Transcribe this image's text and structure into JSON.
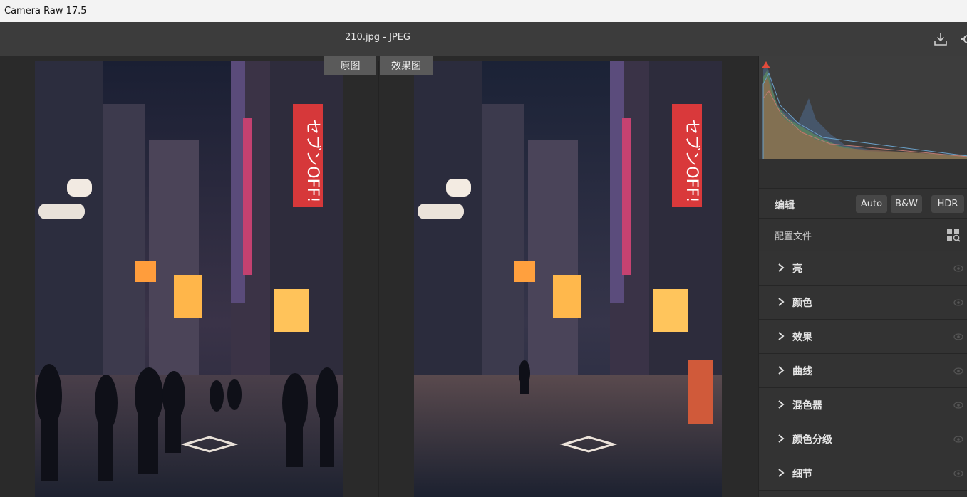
{
  "app": {
    "title": "Camera Raw 17.5"
  },
  "toolbar": {
    "file_title": "210.jpg -  JPEG",
    "export_icon": "export-icon",
    "settings_icon": "gear-icon"
  },
  "view_tabs": {
    "original": "原图",
    "edited": "效果图"
  },
  "panel": {
    "edit_label": "编辑",
    "modes": {
      "auto": "Auto",
      "bw": "B&W",
      "hdr": "HDR"
    },
    "profile_label": "配置文件",
    "sections": [
      {
        "label": "亮"
      },
      {
        "label": "颜色"
      },
      {
        "label": "效果"
      },
      {
        "label": "曲线"
      },
      {
        "label": "混色器"
      },
      {
        "label": "颜色分级"
      },
      {
        "label": "细节"
      }
    ]
  },
  "colors": {
    "titlebar": "#f3f3f3",
    "toolbar": "#3c3c3c",
    "panel": "#323232",
    "accent_warning": "#e24b3b"
  }
}
